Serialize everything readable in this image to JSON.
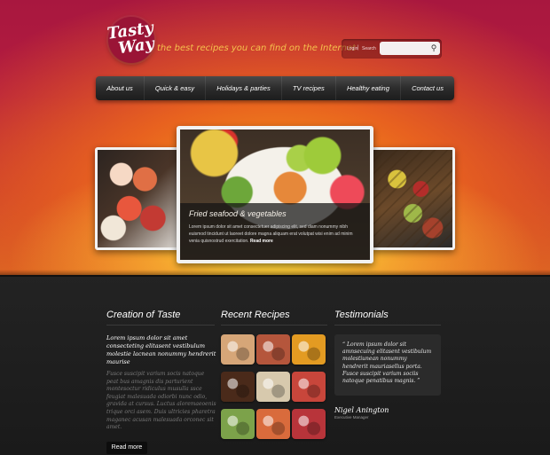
{
  "header": {
    "logo_line1": "Tasty",
    "logo_line2": "Way",
    "tagline": "the best recipes you can find on the Internet",
    "login_label": "Login",
    "separator": "|",
    "search_label": "Search"
  },
  "nav": {
    "items": [
      {
        "label": "About us"
      },
      {
        "label": "Quick & easy"
      },
      {
        "label": "Holidays & parties"
      },
      {
        "label": "TV recipes"
      },
      {
        "label": "Healthy eating"
      },
      {
        "label": "Contact us"
      }
    ]
  },
  "slider": {
    "caption_title": "Fried seafood & vegetables",
    "caption_text": "Lorem ipsum dolor sit amet consectetuer adipiscing elit, sed diam nonummy nibh euismod tincidunt ut laoreet dolore magna aliquam erat volutpat wisi enim ad minim venia quisnostrud exercitation.",
    "read_more": "Read more"
  },
  "creation": {
    "title": "Creation of Taste",
    "lead": "Lorem ipsum dolor sit amet consecteting elitasent vestibulum molestie lacnean nonummy hendrerit maurise",
    "body": "Fusce suscipit varium socis natoque peat bus amagnis dis parturient montesoctur ridiculus musulla ssce feugiat malesuada odiorbi nunc odio, gravida at cursus. Luctus aloremaeoenis trique orci asem. Duis ultricies pharetra maganec acusan malesuada orconec sit amet.",
    "read_more": "Read more"
  },
  "recent": {
    "title": "Recent Recipes",
    "thumbs": [
      {
        "icon": "dessert-thumb",
        "color": "#d6a678"
      },
      {
        "icon": "seafood-thumb",
        "color": "#b5563c"
      },
      {
        "icon": "soup-thumb",
        "color": "#e39b22"
      },
      {
        "icon": "grill-thumb",
        "color": "#4a2a1a"
      },
      {
        "icon": "sushi-thumb",
        "color": "#d7c9ad"
      },
      {
        "icon": "salad-thumb",
        "color": "#c8463b"
      },
      {
        "icon": "veg-thumb",
        "color": "#7ca24a"
      },
      {
        "icon": "shrimp-thumb",
        "color": "#d96b3c"
      },
      {
        "icon": "meat-thumb",
        "color": "#b8343a"
      }
    ]
  },
  "testimonials": {
    "title": "Testimonials",
    "quote": "“ Lorem ipsum dolor sit amnsecuing elitasent vestibulum molestiunean nonummy hendrerit mauriasellus porta. Fusce suscipit varium sociis natoque penatibus magnis. ”",
    "name": "Nigel Anington",
    "role": "Executive Manager"
  }
}
